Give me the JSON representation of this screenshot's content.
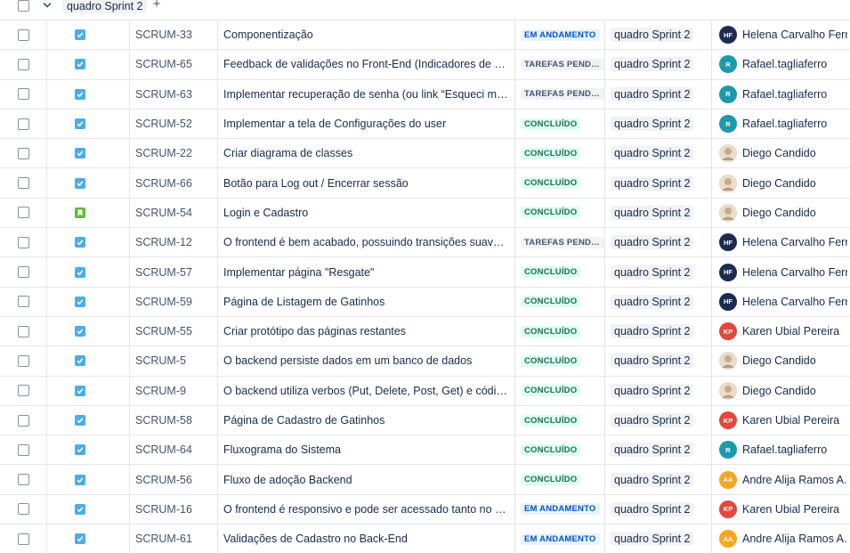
{
  "group": {
    "title": "quadro Sprint 2",
    "add_label": "+"
  },
  "colors": {
    "task": "#4bade8",
    "story": "#63ba3c",
    "in_progress_bg": "#e9f2ff",
    "todo_bg": "#f1f2f4",
    "done_bg": "#dcfff1"
  },
  "rows": [
    {
      "type": "task",
      "key": "SCRUM-33",
      "summary": "Componentização",
      "status": "EM ANDAMENTO",
      "status_kind": "progress",
      "sprint": "quadro Sprint 2",
      "assignee": "Helena Carvalho Ferr...",
      "initials": "HF",
      "avatar_color": "#1d2b4f"
    },
    {
      "type": "task",
      "key": "SCRUM-65",
      "summary": "Feedback de validações no Front-End (Indicadores de senha ...",
      "status": "TAREFAS PENDE...",
      "status_kind": "todo",
      "sprint": "quadro Sprint 2",
      "assignee": "Rafael.tagliaferro",
      "initials": "R",
      "avatar_color": "#1d9aaa"
    },
    {
      "type": "task",
      "key": "SCRUM-63",
      "summary": "Implementar recuperação de senha (ou link “Esqueci minha s...",
      "status": "TAREFAS PENDE...",
      "status_kind": "todo",
      "sprint": "quadro Sprint 2",
      "assignee": "Rafael.tagliaferro",
      "initials": "R",
      "avatar_color": "#1d9aaa"
    },
    {
      "type": "task",
      "key": "SCRUM-52",
      "summary": "Implementar a tela de Configurações do user",
      "status": "CONCLUÍDO",
      "status_kind": "done",
      "sprint": "quadro Sprint 2",
      "assignee": "Rafael.tagliaferro",
      "initials": "R",
      "avatar_color": "#1d9aaa"
    },
    {
      "type": "task",
      "key": "SCRUM-22",
      "summary": "Criar diagrama de classes",
      "status": "CONCLUÍDO",
      "status_kind": "done",
      "sprint": "quadro Sprint 2",
      "assignee": "Diego Candido",
      "initials": "",
      "avatar_color": "#d9c2a8"
    },
    {
      "type": "task",
      "key": "SCRUM-66",
      "summary": "Botão para Log out / Encerrar sessão",
      "status": "CONCLUÍDO",
      "status_kind": "done",
      "sprint": "quadro Sprint 2",
      "assignee": "Diego Candido",
      "initials": "",
      "avatar_color": "#d9c2a8"
    },
    {
      "type": "story",
      "key": "SCRUM-54",
      "summary": "Login e Cadastro",
      "status": "CONCLUÍDO",
      "status_kind": "done",
      "sprint": "quadro Sprint 2",
      "assignee": "Diego Candido",
      "initials": "",
      "avatar_color": "#d9c2a8"
    },
    {
      "type": "task",
      "key": "SCRUM-12",
      "summary": "O frontend é bem acabado, possuindo transições suaves, me...",
      "status": "TAREFAS PENDE...",
      "status_kind": "todo",
      "sprint": "quadro Sprint 2",
      "assignee": "Helena Carvalho Ferr...",
      "initials": "HF",
      "avatar_color": "#1d2b4f"
    },
    {
      "type": "task",
      "key": "SCRUM-57",
      "summary": "Implementar página \"Resgate\"",
      "status": "CONCLUÍDO",
      "status_kind": "done",
      "sprint": "quadro Sprint 2",
      "assignee": "Helena Carvalho Ferr...",
      "initials": "HF",
      "avatar_color": "#1d2b4f"
    },
    {
      "type": "task",
      "key": "SCRUM-59",
      "summary": "Página de Listagem de Gatinhos",
      "status": "CONCLUÍDO",
      "status_kind": "done",
      "sprint": "quadro Sprint 2",
      "assignee": "Helena Carvalho Ferr...",
      "initials": "HF",
      "avatar_color": "#1d2b4f"
    },
    {
      "type": "task",
      "key": "SCRUM-55",
      "summary": "Criar protótipo das páginas restantes",
      "status": "CONCLUÍDO",
      "status_kind": "done",
      "sprint": "quadro Sprint 2",
      "assignee": "Karen Ubial Pereira",
      "initials": "KP",
      "avatar_color": "#e2483d"
    },
    {
      "type": "task",
      "key": "SCRUM-5",
      "summary": "O backend persiste dados em um banco de dados",
      "status": "CONCLUÍDO",
      "status_kind": "done",
      "sprint": "quadro Sprint 2",
      "assignee": "Diego Candido",
      "initials": "",
      "avatar_color": "#d9c2a8"
    },
    {
      "type": "task",
      "key": "SCRUM-9",
      "summary": "O backend utiliza verbos (Put, Delete, Post, Get) e códigos H...",
      "status": "CONCLUÍDO",
      "status_kind": "done",
      "sprint": "quadro Sprint 2",
      "assignee": "Diego Candido",
      "initials": "",
      "avatar_color": "#d9c2a8"
    },
    {
      "type": "task",
      "key": "SCRUM-58",
      "summary": "Página de Cadastro de Gatinhos",
      "status": "CONCLUÍDO",
      "status_kind": "done",
      "sprint": "quadro Sprint 2",
      "assignee": "Karen Ubial Pereira",
      "initials": "KP",
      "avatar_color": "#e2483d"
    },
    {
      "type": "task",
      "key": "SCRUM-64",
      "summary": "Fluxograma do Sistema",
      "status": "CONCLUÍDO",
      "status_kind": "done",
      "sprint": "quadro Sprint 2",
      "assignee": "Rafael.tagliaferro",
      "initials": "R",
      "avatar_color": "#1d9aaa"
    },
    {
      "type": "task",
      "key": "SCRUM-56",
      "summary": "Fluxo de adoção Backend",
      "status": "CONCLUÍDO",
      "status_kind": "done",
      "sprint": "quadro Sprint 2",
      "assignee": "Andre Alija Ramos A...",
      "initials": "AA",
      "avatar_color": "#f5a623"
    },
    {
      "type": "task",
      "key": "SCRUM-16",
      "summary": "O frontend é responsivo e pode ser acessado tanto no comp...",
      "status": "EM ANDAMENTO",
      "status_kind": "progress",
      "sprint": "quadro Sprint 2",
      "assignee": "Karen Ubial Pereira",
      "initials": "KP",
      "avatar_color": "#e2483d"
    },
    {
      "type": "task",
      "key": "SCRUM-61",
      "summary": "Validações de Cadastro no Back-End",
      "status": "EM ANDAMENTO",
      "status_kind": "progress",
      "sprint": "quadro Sprint 2",
      "assignee": "Andre Alija Ramos A...",
      "initials": "AA",
      "avatar_color": "#f5a623"
    }
  ]
}
